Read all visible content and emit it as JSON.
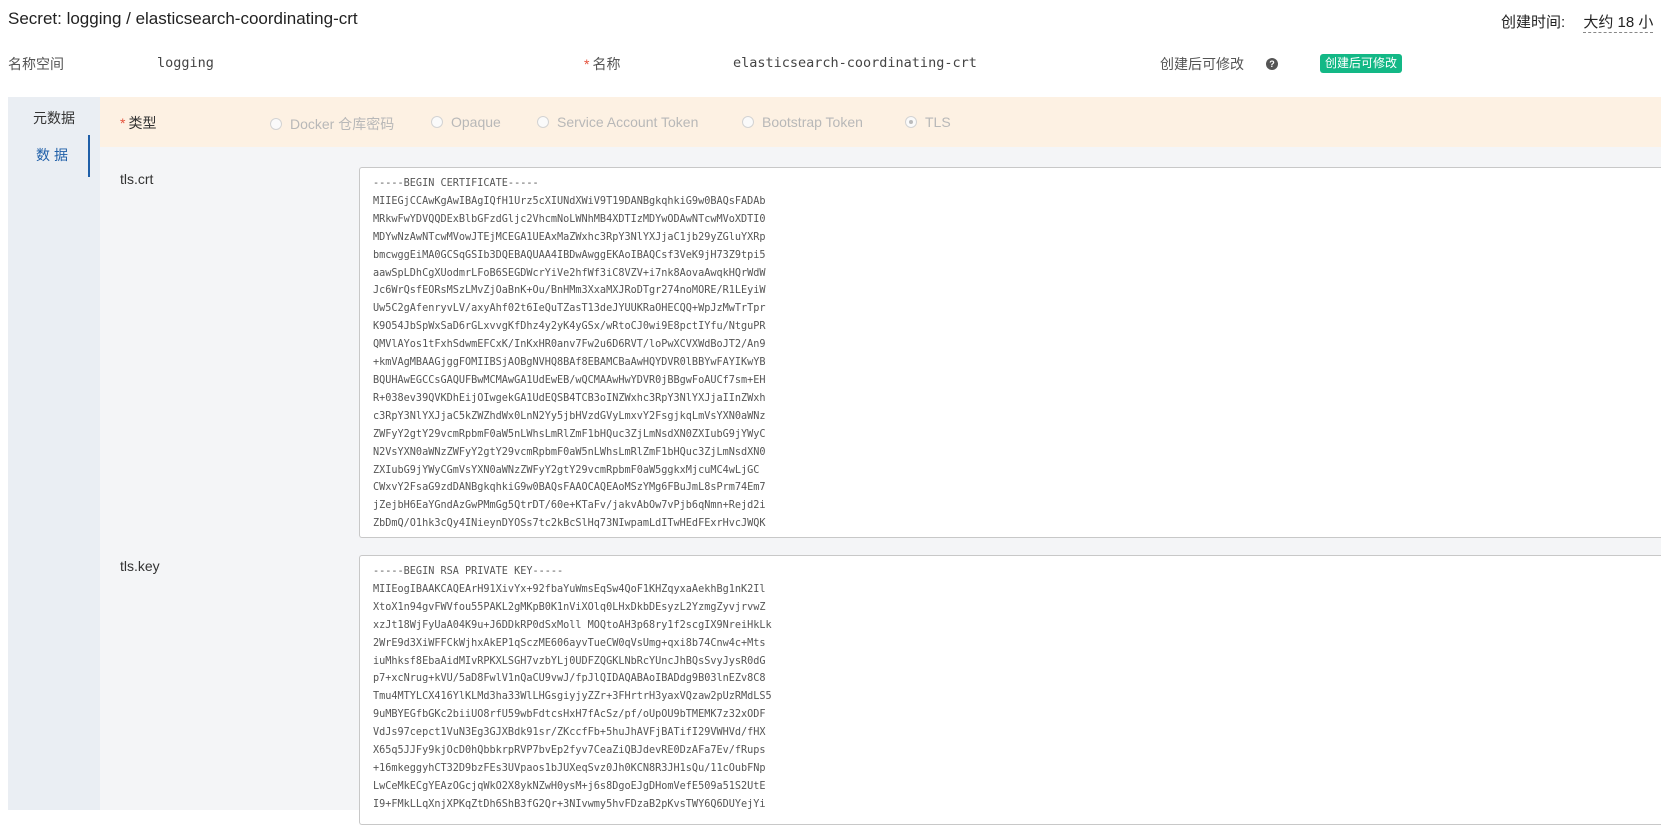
{
  "header": {
    "title": "Secret: logging / elasticsearch-coordinating-crt",
    "created_label": "创建时间:",
    "created_value": "大约 18 小"
  },
  "meta": {
    "namespace_label": "名称空间",
    "namespace_value": "logging",
    "name_required": "*",
    "name_label": "名称",
    "name_value": "elasticsearch-coordinating-crt",
    "editable_label": "创建后可修改",
    "editable_badge": "创建后可修改"
  },
  "sidebar": {
    "items": [
      {
        "label": "元数据",
        "active": false
      },
      {
        "label": "数据",
        "active": true
      }
    ]
  },
  "type_section": {
    "required": "*",
    "label": "类型",
    "options": [
      {
        "label": "Docker 仓库密码",
        "checked": false
      },
      {
        "label": "Opaque",
        "checked": false
      },
      {
        "label": "Service Account Token",
        "checked": false
      },
      {
        "label": "Bootstrap Token",
        "checked": false
      },
      {
        "label": "TLS",
        "checked": true
      }
    ]
  },
  "fields": [
    {
      "label": "tls.crt",
      "value": "-----BEGIN CERTIFICATE-----\nMIIEGjCCAwKgAwIBAgIQfH1Urz5cXIUNdXWiV9T19DANBgkqhkiG9w0BAQsFADAb\nMRkwFwYDVQQDExBlbGFzdGljc2VhcmNoLWNhMB4XDTIzMDYwODAwNTcwMVoXDTI0\nMDYwNzAwNTcwMVowJTEjMCEGA1UEAxMaZWxhc3RpY3NlYXJjaC1jb29yZGluYXRp\nbmcwggEiMA0GCSqGSIb3DQEBAQUAA4IBDwAwggEKAoIBAQCsf3VeK9jH73Z9tpi5\naawSpLDhCgXUodmrLFoB6SEGDWcrYiVe2hfWf3iC8VZV+i7nk8AovaAwqkHQrWdW\nJc6WrQsfEORsMSzLMvZjOaBnK+Ou/BnHMm3XxaMXJRoDTgr274noMORE/R1LEyiW\nUw5C2gAfenryvLV/axyAhf02t6IeQuTZasT13deJYUUKRaOHECQQ+WpJzMwTrTpr\nK9O54JbSpWxSaD6rGLxvvgKfDhz4y2yK4yGSx/wRtoCJ0wi9E8pctIYfu/NtguPR\nQMVlAYos1tFxhSdwmEFCxK/InKxHR0anv7Fw2u6D6RVT/loPwXCVXWdBoJT2/An9\n+kmVAgMBAAGjggFOMIIBSjAOBgNVHQ8BAf8EBAMCBaAwHQYDVR0lBBYwFAYIKwYB\nBQUHAwEGCCsGAQUFBwMCMAwGA1UdEwEB/wQCMAAwHwYDVR0jBBgwFoAUCf7sm+EH\nR+038ev39QVKDhEijOIwgekGA1UdEQSB4TCB3oINZWxhc3RpY3NlYXJjaIInZWxh\nc3RpY3NlYXJjaC5kZWZhdWx0LnN2Yy5jbHVzdGVyLmxvY2FsgjkqLmVsYXN0aWNz\nZWFyY2gtY29vcmRpbmF0aW5nLWhsLmRlZmF1bHQuc3ZjLmNsdXN0ZXIubG9jYWyC\nN2VsYXN0aWNzZWFyY2gtY29vcmRpbmF0aW5nLWhsLmRlZmF1bHQuc3ZjLmNsdXN0\nZXIubG9jYWyCGmVsYXN0aWNzZWFyY2gtY29vcmRpbmF0aW5ggkxMjcuMC4wLjGC\nCWxvY2FsaG9zdDANBgkqhkiG9w0BAQsFAAOCAQEAoMSzYMg6FBuJmL8sPrm74Em7\njZejbH6EaYGndAzGwPMmGg5QtrDT/60e+KTaFv/jakvAbOw7vPjb6qNmn+Rejd2i\nZbDmQ/O1hk3cQy4INieynDYOSs7tc2kBcSlHq73NIwpamLdITwHEdFExrHvcJWQK"
    },
    {
      "label": "tls.key",
      "value": "-----BEGIN RSA PRIVATE KEY-----\nMIIEogIBAAKCAQEArH91XivYx+92fbaYuWmsEqSw4QoF1KHZqyxaAekhBg1nK2Il\nXtoX1n94gvFWVfou55PAKL2gMKpB0K1nViXOlq0LHxDkbDEsyzL2YzmgZyvjrvwZ\nxzJt18WjFyUaA04K9u+J6DDkRP0dSxMoll MOQtoAH3p68ry1f2scgIX9NreiHkLk\n2WrE9d3XiWFFCkWjhxAkEP1qSczME606ayvTueCW0qVsUmg+qxi8b74Cnw4c+Mts\niuMhksf8EbaAidMIvRPKXLSGH7vzbYLj0UDFZQGKLNbRcYUncJhBQsSvyJysR0dG\np7+xcNrug+kVU/5aD8FwlV1nQaCU9vwJ/fpJlQIDAQABAoIBADdg9B03lnEZv8C8\nTmu4MTYLCX416YlKLMd3ha33WlLHGsgiyjyZZr+3FHrtrH3yaxVQzaw2pUzRMdLS5\n9uMBYEGfbGKc2biiUO8rfU59wbFdtcsHxH7fAcSz/pf/oUpOU9bTMEMK7z32xODF\nVdJs97cepct1VuN3Eg3GJXBdk91sr/ZKccfFb+5huJhAVFjBATifI29VWHVd/fHX\nX65q5JJFy9kjOcD0hQbbkrpRVP7bvEp2fyv7CeaZiQBJdevRE0DzAFa7Ev/fRups\n+16mkeggyhCT32D9bzFEs3UVpaos1bJUXeqSvz0Jh0KCN8R3JH1sQu/11cOubFNp\nLwCeMkECgYEAzOGcjqWkO2X8ykNZwH0ysM+j6s8DgoEJgDHomVefE509a51S2UtE\nI9+FMkLLqXnjXPKqZtDh6ShB3fG2Qr+3NIvwmy5hvFDzaB2pKvsTWY6Q6DUYejYi"
    }
  ]
}
